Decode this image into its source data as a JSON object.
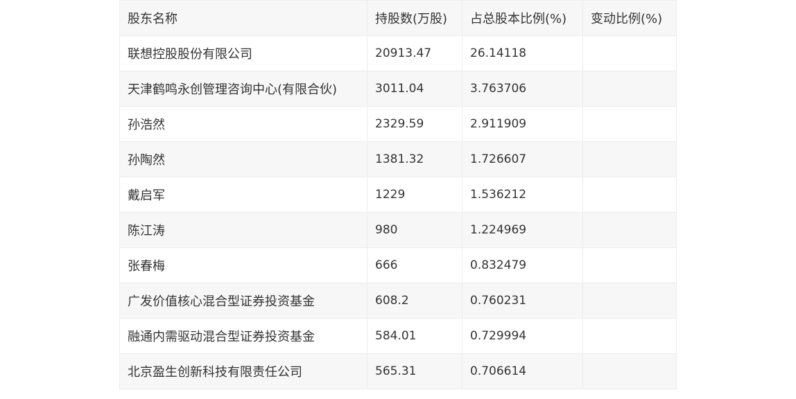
{
  "table": {
    "headers": [
      "股东名称",
      "持股数(万股)",
      "占总股本比例(%)",
      "变动比例(%)"
    ],
    "rows": [
      [
        "联想控股股份有限公司",
        "20913.47",
        "26.14118",
        ""
      ],
      [
        "天津鹤鸣永创管理咨询中心(有限合伙)",
        "3011.04",
        "3.763706",
        ""
      ],
      [
        "孙浩然",
        "2329.59",
        "2.911909",
        ""
      ],
      [
        "孙陶然",
        "1381.32",
        "1.726607",
        ""
      ],
      [
        "戴启军",
        "1229",
        "1.536212",
        ""
      ],
      [
        "陈江涛",
        "980",
        "1.224969",
        ""
      ],
      [
        "张春梅",
        "666",
        "0.832479",
        ""
      ],
      [
        "广发价值核心混合型证券投资基金",
        "608.2",
        "0.760231",
        ""
      ],
      [
        "融通内需驱动混合型证券投资基金",
        "584.01",
        "0.729994",
        ""
      ],
      [
        "北京盈生创新科技有限责任公司",
        "565.31",
        "0.706614",
        ""
      ]
    ]
  }
}
